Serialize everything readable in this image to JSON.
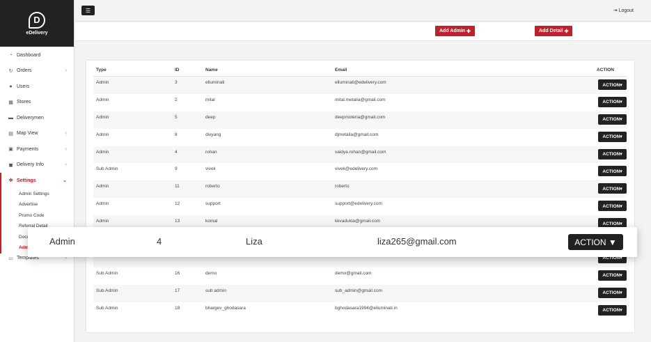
{
  "brand": {
    "name": "eDelivery",
    "logo_letter": "D"
  },
  "sidebar": {
    "items": [
      {
        "label": "Dashboard",
        "icon": "dashboard-icon",
        "glyph": "◔",
        "chevron": ""
      },
      {
        "label": "Orders",
        "icon": "orders-icon",
        "glyph": "↻",
        "chevron": "‹"
      },
      {
        "label": "Users",
        "icon": "user-icon",
        "glyph": "●",
        "chevron": ""
      },
      {
        "label": "Stores",
        "icon": "store-icon",
        "glyph": "▦",
        "chevron": ""
      },
      {
        "label": "Deliverymen",
        "icon": "truck-icon",
        "glyph": "▬",
        "chevron": ""
      },
      {
        "label": "Map View",
        "icon": "map-icon",
        "glyph": "▤",
        "chevron": "‹"
      },
      {
        "label": "Payments",
        "icon": "payment-icon",
        "glyph": "▣",
        "chevron": "‹"
      },
      {
        "label": "Delivery Info",
        "icon": "delivery-info-icon",
        "glyph": "◼",
        "chevron": "‹"
      },
      {
        "label": "Settings",
        "icon": "gear-icon",
        "glyph": "✲",
        "chevron": "⌄"
      }
    ],
    "settings_sub": [
      "Admin Settings",
      "Advertise",
      "Promo Code",
      "Referral Detail",
      "Documents",
      "Admin"
    ],
    "templates": {
      "label": "Templates",
      "glyph": "▭",
      "chevron": "‹"
    }
  },
  "topbar": {
    "menu_glyph": "☰",
    "logout_label": "Logout",
    "logout_glyph": "⇥"
  },
  "actions": {
    "add_admin": "Add Admin",
    "add_detail": "Add Detail",
    "plus": "✚"
  },
  "table": {
    "headers": {
      "type": "Type",
      "id": "ID",
      "name": "Name",
      "email": "Email",
      "action": "ACTION"
    },
    "action_label": "ACTION▾",
    "rows": [
      {
        "type": "Admin",
        "id": "3",
        "name": "elluminati",
        "email": "elluminati@edelivery.com"
      },
      {
        "type": "Admin",
        "id": "2",
        "name": "mital",
        "email": "mital.metalia@gmail.com"
      },
      {
        "type": "Admin",
        "id": "5",
        "name": "deep",
        "email": "deepmoteria@gmail.com"
      },
      {
        "type": "Admin",
        "id": "8",
        "name": "divyang",
        "email": "djmetalia@gmail.com"
      },
      {
        "type": "Admin",
        "id": "4",
        "name": "rohan",
        "email": "vaidya.rohan@gmail.com"
      },
      {
        "type": "Sub Admin",
        "id": "9",
        "name": "vivek",
        "email": "vivek@edelivery.com"
      },
      {
        "type": "Admin",
        "id": "11",
        "name": "roberto",
        "email": "roberto"
      },
      {
        "type": "Admin",
        "id": "12",
        "name": "support",
        "email": "support@edelivery.com"
      },
      {
        "type": "Admin",
        "id": "13",
        "name": "komal",
        "email": "kkvadukia@gmail.com"
      },
      {
        "type": "",
        "id": "",
        "name": "",
        "email": ""
      },
      {
        "type": "",
        "id": "",
        "name": "",
        "email": ""
      },
      {
        "type": "Sub Admin",
        "id": "16",
        "name": "demo",
        "email": "demo@gmail.com"
      },
      {
        "type": "Sub Admin",
        "id": "17",
        "name": "sub admin",
        "email": "sub_admin@gmail.com"
      },
      {
        "type": "Sub Admin",
        "id": "18",
        "name": "bhargev_ghodasara",
        "email": "bghodasara1994@elluminati.in"
      }
    ]
  },
  "zoom_row": {
    "type": "Admin",
    "id": "4",
    "name": "Liza",
    "email": "liza265@gmail.com",
    "action": "ACTION ▼"
  }
}
